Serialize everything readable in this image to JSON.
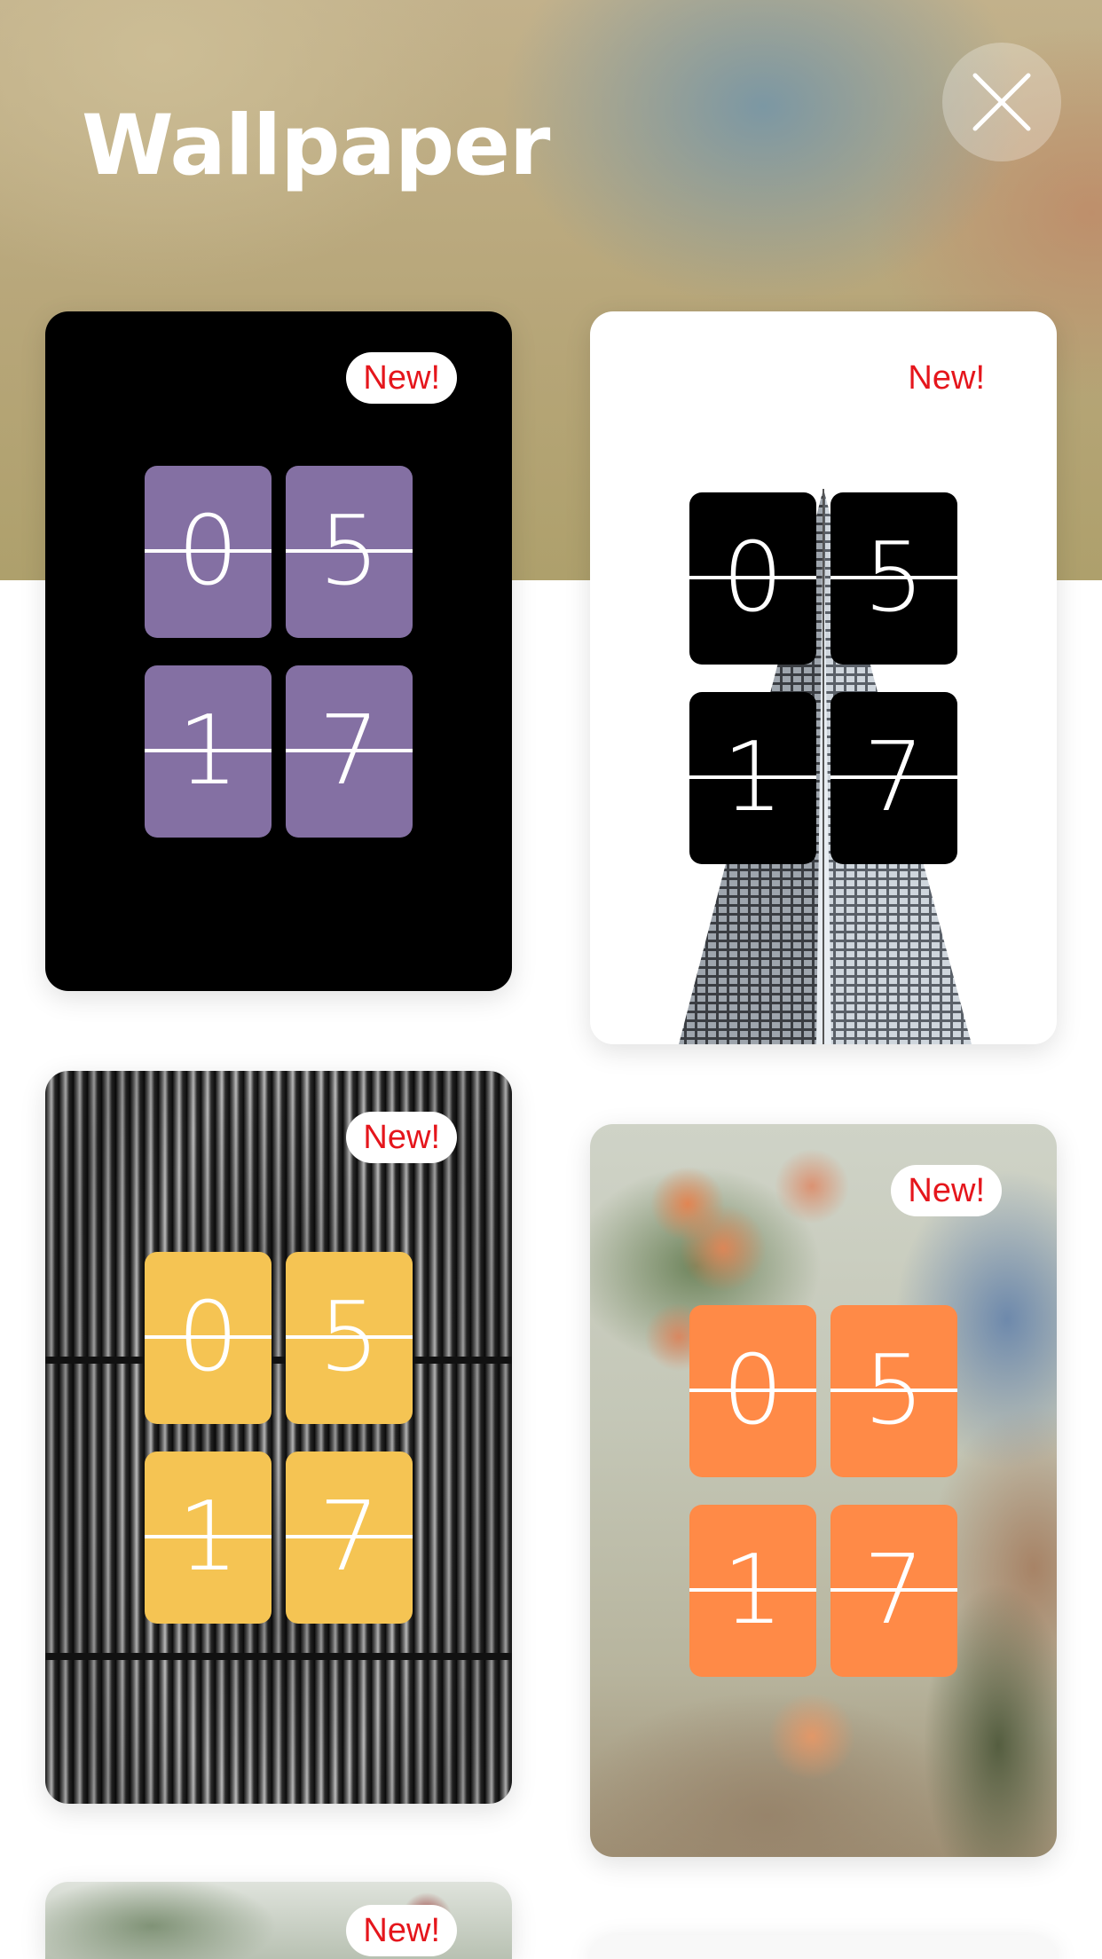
{
  "header": {
    "title": "Wallpaper",
    "close_icon": "close-icon"
  },
  "badge_text": "New!",
  "clock": {
    "digits": [
      "0",
      "5",
      "1",
      "7"
    ]
  },
  "cards": [
    {
      "badge": "New!",
      "background": "black",
      "tile_color": "#8470a3"
    },
    {
      "badge": "New!",
      "background": "white-with-skyscraper",
      "tile_color": "#000000"
    },
    {
      "badge": "New!",
      "background": "metallic-pattern",
      "tile_color": "#f5c453"
    },
    {
      "badge": "New!",
      "background": "nature-photo",
      "tile_color": "#ff8a47"
    },
    {
      "badge": "New!",
      "background": "leaves-photo"
    }
  ],
  "colors": {
    "badge_text": "#e5161c",
    "purple_tile": "#8470a3",
    "black_tile": "#000000",
    "yellow_tile": "#f5c453",
    "orange_tile": "#ff8a47"
  }
}
